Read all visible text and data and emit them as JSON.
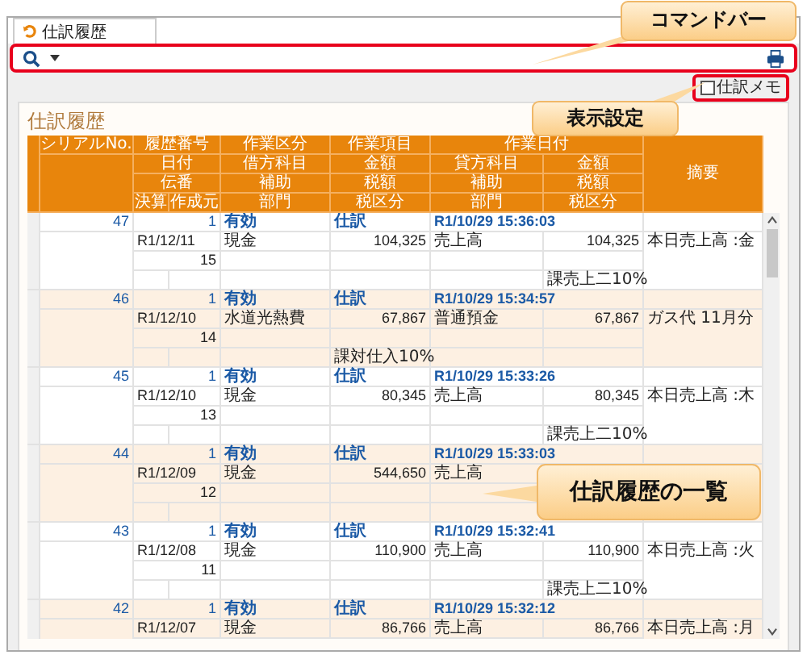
{
  "tab": {
    "label": "仕訳履歴",
    "selected": true
  },
  "memo_checkbox": {
    "label": "仕訳メモ",
    "checked": false
  },
  "panel": {
    "title": "仕訳履歴"
  },
  "table": {
    "header_rows": [
      [
        "シリアルNo.",
        "履歴番号",
        "作業区分",
        "作業項目",
        "作業日付",
        "摘要"
      ],
      [
        "日付",
        "借方科目",
        "金額",
        "貸方科目",
        "金額"
      ],
      [
        "伝番",
        "補助",
        "税額",
        "補助",
        "税額"
      ],
      [
        "決算",
        "作成元",
        "部門",
        "税区分",
        "部門",
        "税区分"
      ]
    ],
    "records": [
      {
        "serial": "47",
        "history_no": "1",
        "status": "有効",
        "work_item": "仕訳",
        "work_date": "R1/10/29 15:36:03",
        "date": "R1/12/11",
        "debit_account": "現金",
        "debit_amount": "104,325",
        "credit_account": "売上高",
        "credit_amount": "104,325",
        "summary": "本日売上高 :金",
        "voucher_no": "15",
        "credit_tax_class": "課売上二10%"
      },
      {
        "serial": "46",
        "history_no": "1",
        "status": "有効",
        "work_item": "仕訳",
        "work_date": "R1/10/29 15:34:57",
        "date": "R1/12/10",
        "debit_account": "水道光熱費",
        "debit_amount": "67,867",
        "credit_account": "普通預金",
        "credit_amount": "67,867",
        "summary": "ガス代 11月分",
        "voucher_no": "14",
        "debit_tax_class": "課対仕入10%"
      },
      {
        "serial": "45",
        "history_no": "1",
        "status": "有効",
        "work_item": "仕訳",
        "work_date": "R1/10/29 15:33:26",
        "date": "R1/12/10",
        "debit_account": "現金",
        "debit_amount": "80,345",
        "credit_account": "売上高",
        "credit_amount": "80,345",
        "summary": "本日売上高 :木",
        "voucher_no": "13",
        "credit_tax_class": "課売上二10%"
      },
      {
        "serial": "44",
        "history_no": "1",
        "status": "有効",
        "work_item": "仕訳",
        "work_date": "R1/10/29 15:33:03",
        "date": "R1/12/09",
        "debit_account": "現金",
        "debit_amount": "544,650",
        "credit_account": "売上高",
        "voucher_no": "12"
      },
      {
        "serial": "43",
        "history_no": "1",
        "status": "有効",
        "work_item": "仕訳",
        "work_date": "R1/10/29 15:32:41",
        "date": "R1/12/08",
        "debit_account": "現金",
        "debit_amount": "110,900",
        "credit_account": "売上高",
        "credit_amount": "110,900",
        "summary": "本日売上高 :火",
        "voucher_no": "11",
        "credit_tax_class": "課売上二10%"
      },
      {
        "serial": "42",
        "history_no": "1",
        "status": "有効",
        "work_item": "仕訳",
        "work_date": "R1/10/29 15:32:12",
        "date": "R1/12/07",
        "debit_account": "現金",
        "debit_amount": "86,766",
        "credit_account": "売上高",
        "credit_amount": "86,766",
        "summary": "本日売上高 :月"
      }
    ]
  },
  "callouts": [
    {
      "text": "コマンドバー"
    },
    {
      "text": "表示設定"
    },
    {
      "text": "仕訳履歴の一覧"
    }
  ]
}
